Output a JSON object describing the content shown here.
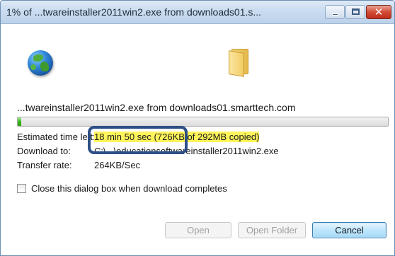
{
  "window": {
    "title": "1% of ...twareinstaller2011win2.exe from downloads01.s...",
    "minimize_label": "minimize",
    "maximize_label": "maximize",
    "close_glyph": "✕"
  },
  "icons": {
    "source": "globe-icon",
    "destination": "folder-icon"
  },
  "download": {
    "filename_line": "...twareinstaller2011win2.exe from downloads01.smarttech.com",
    "progress_fraction": 0.01,
    "progress_color": "#35b51b",
    "eta_label": "Estimated time left:",
    "eta_value": "18 min 50 sec (726KB of 292MB copied)",
    "download_to_label": "Download to:",
    "download_to_value": "C:\\...\\educationsoftwareinstaller2011win2.exe",
    "rate_label": "Transfer rate:",
    "rate_value": "264KB/Sec"
  },
  "annotation": {
    "highlight_color": "#fff45a",
    "callout_color": "#2c4f86"
  },
  "options": {
    "close_on_complete_label": "Close this dialog box when download completes",
    "close_on_complete_checked": false
  },
  "buttons": {
    "open": "Open",
    "open_folder": "Open Folder",
    "cancel": "Cancel"
  }
}
